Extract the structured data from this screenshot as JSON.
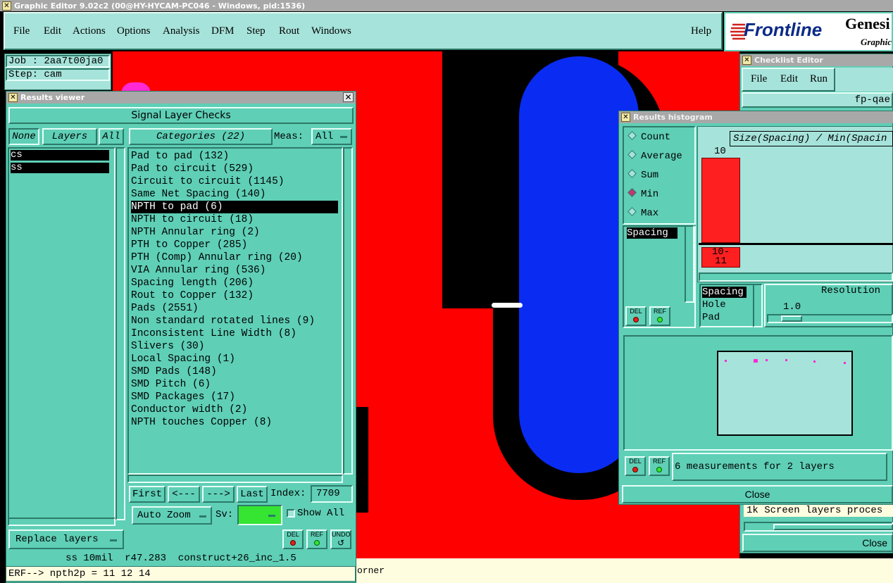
{
  "window_title": "Graphic Editor 9.02c2 (00@HY-HYCAM-PC046 - Windows, pid:1536)",
  "menu": [
    "File",
    "Edit",
    "Actions",
    "Options",
    "Analysis",
    "DFM",
    "Step",
    "Rout",
    "Windows"
  ],
  "menu_help": "Help",
  "brand": {
    "logo": "Frontline",
    "product": "Genesi",
    "subtitle": "Graphic",
    "logo_color": "#d0201a"
  },
  "job": {
    "job_label": "Job : 2aa7t00ja0",
    "step_label": "Step: cam"
  },
  "results_viewer": {
    "title": "Results viewer",
    "header": "Signal Layer Checks",
    "none_btn": "None",
    "layers_btn": "Layers",
    "all_btn": "All",
    "layers": [
      "cs",
      "ss"
    ],
    "categories_btn": "Categories (22)",
    "meas_label": "Meas:",
    "meas_value": "All",
    "categories": [
      "Pad to pad (132)",
      "Pad to circuit (529)",
      "Circuit to circuit (1145)",
      "Same Net Spacing (140)",
      "NPTH to pad (6)",
      "NPTH to circuit (18)",
      "NPTH Annular ring (2)",
      "PTH to Copper (285)",
      "PTH (Comp) Annular ring (20)",
      "VIA Annular ring (536)",
      "Spacing length (206)",
      "Rout to Copper (132)",
      "Pads (2551)",
      "Non standard rotated lines (9)",
      "Inconsistent Line Width (8)",
      "Slivers (30)",
      "Local Spacing (1)",
      "SMD Pads (148)",
      "SMD Pitch (6)",
      "SMD Packages (17)",
      "Conductor width (2)",
      "NPTH touches Copper (8)"
    ],
    "selected_category": "NPTH to pad (6)",
    "first_btn": "First",
    "prev_btn": "<---",
    "next_btn": "--->",
    "last_btn": "Last",
    "index_label": "Index:",
    "index_value": "7709",
    "replace_layers": "Replace layers",
    "auto_zoom": "Auto Zoom",
    "sv_label": "Sv:",
    "show_all": "Show All",
    "del": "DEL",
    "ref": "REF",
    "undo": "UNDO",
    "status_line": "ss 10mil  r47.283  construct+26_inc_1.5",
    "erf_line": "ERF--> npth2p = 11 12 14"
  },
  "checklist_editor": {
    "title": "Checklist Editor",
    "menu": [
      "File",
      "Edit",
      "Run"
    ],
    "name": "fp-qae",
    "log": "1k Screen layers proces",
    "close": "Close"
  },
  "histogram": {
    "title": "Results histogram",
    "modes": [
      "Count",
      "Average",
      "Sum",
      "Min",
      "Max"
    ],
    "selected_mode": "Min",
    "list": [
      "Spacing"
    ],
    "chart_title": "Size(Spacing) / Min(Spacin",
    "bar_value": "10",
    "bar_label": "10-\n11",
    "bar_fraction": 1.0,
    "types": [
      "Spacing",
      "Hole",
      "Pad"
    ],
    "resolution_label": "Resolution",
    "resolution_value": "1.0",
    "del": "DEL",
    "ref": "REF",
    "status": "6 measurements for 2 layers",
    "close": "Close"
  },
  "bottom_text": "orner",
  "colors": {
    "teal": "#5fcfb6",
    "light": "#a6e3da",
    "red": "#fe0000",
    "blue": "#0a2cf2",
    "green": "#35e532"
  }
}
